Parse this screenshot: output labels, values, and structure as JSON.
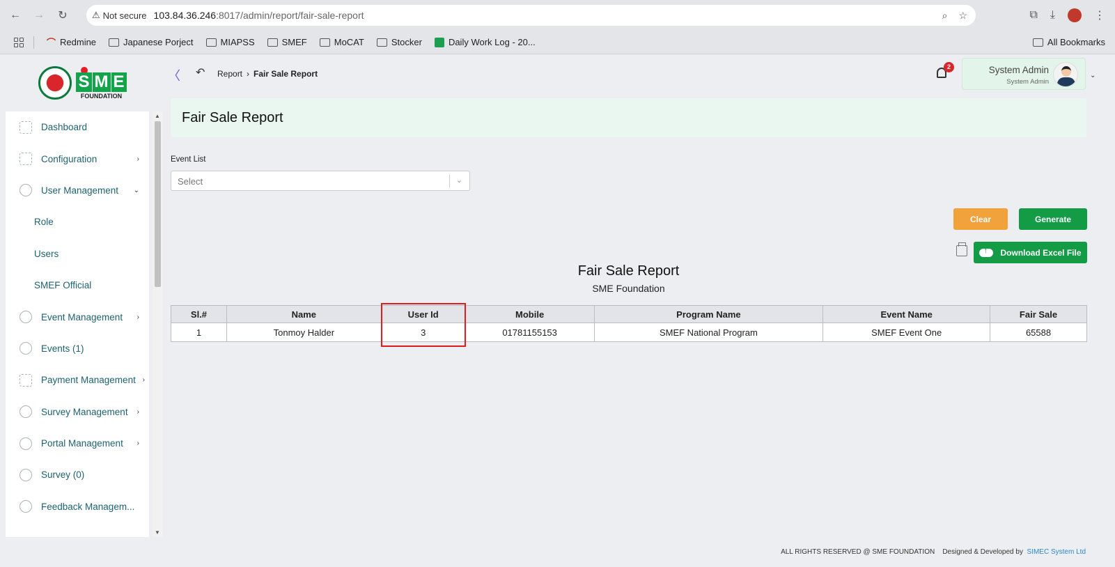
{
  "browser": {
    "warning": "Not secure",
    "url_host": "103.84.36.246",
    "url_path": ":8017/admin/report/fair-sale-report",
    "bookmarks": [
      "Redmine",
      "Japanese Porject",
      "MIAPSS",
      "SMEF",
      "MoCAT",
      "Stocker",
      "Daily Work Log - 20..."
    ],
    "all_bookmarks": "All Bookmarks"
  },
  "logo": {
    "letters": [
      "S",
      "M",
      "E"
    ],
    "sub": "FOUNDATION"
  },
  "sidebar": {
    "items": [
      {
        "label": "Dashboard"
      },
      {
        "label": "Configuration"
      },
      {
        "label": "User Management"
      },
      {
        "label": "Role"
      },
      {
        "label": "Users"
      },
      {
        "label": "SMEF Official"
      },
      {
        "label": "Event Management"
      },
      {
        "label": "Events (1)"
      },
      {
        "label": "Payment Management"
      },
      {
        "label": "Survey Management"
      },
      {
        "label": "Portal Management"
      },
      {
        "label": "Survey (0)"
      },
      {
        "label": "Feedback Managem..."
      }
    ]
  },
  "header": {
    "breadcrumb_parent": "Report",
    "breadcrumb_current": "Fair Sale Report",
    "notification_count": "2",
    "user_name": "System Admin",
    "user_role": "System Admin"
  },
  "page": {
    "title": "Fair Sale Report",
    "event_label": "Event List",
    "select_placeholder": "Select",
    "clear_label": "Clear",
    "generate_label": "Generate",
    "excel_label": "Download Excel File"
  },
  "report": {
    "title": "Fair Sale Report",
    "subtitle": "SME Foundation",
    "columns": [
      "Sl.#",
      "Name",
      "User Id",
      "Mobile",
      "Program Name",
      "Event Name",
      "Fair Sale"
    ],
    "rows": [
      [
        "1",
        "Tonmoy Halder",
        "3",
        "01781155153",
        "SMEF National Program",
        "SMEF Event One",
        "65588"
      ]
    ]
  },
  "footer": {
    "rights": "ALL RIGHTS RESERVED @ SME FOUNDATION",
    "designed": "Designed & Developed by",
    "company": "SIMEC System Ltd"
  }
}
